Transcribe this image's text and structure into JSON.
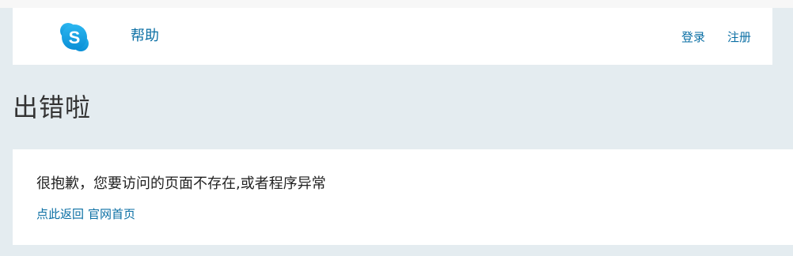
{
  "header": {
    "logo_letter": "S",
    "help_label": "帮助",
    "login_label": "登录",
    "register_label": "注册"
  },
  "page": {
    "title": "出错啦"
  },
  "error": {
    "message": "很抱歉，您要访问的页面不存在,或者程序异常",
    "return_link_label": "点此返回",
    "home_link_label": "官网首页"
  },
  "colors": {
    "page_background": "#e4ecf0",
    "link": "#0b6fa4",
    "logo_blue": "#1aa3e8"
  },
  "icons": {
    "logo": "skype-logo-icon"
  }
}
